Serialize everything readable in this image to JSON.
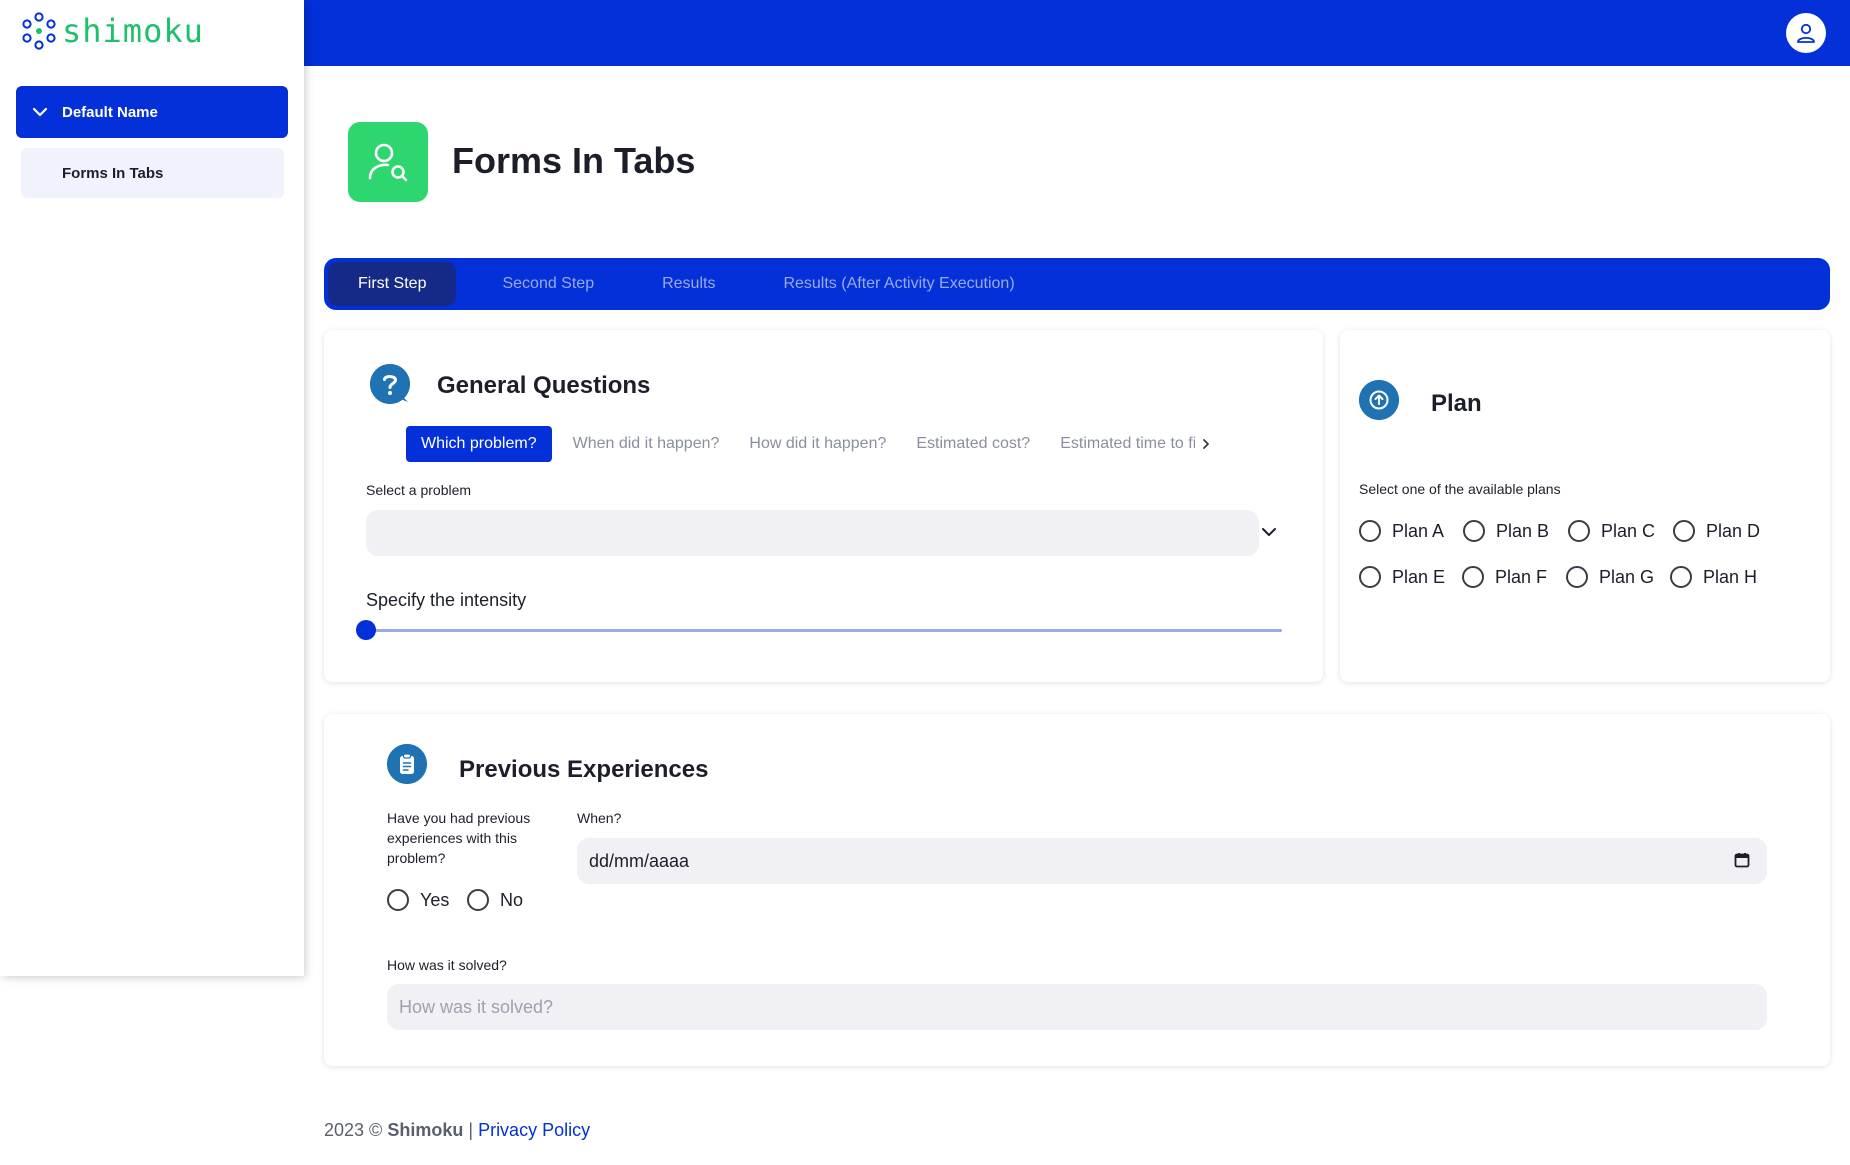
{
  "app": {
    "logo_text": "shimoku",
    "brand_color": "#0330d8",
    "accent_green": "#2ed66f"
  },
  "sidebar": {
    "group_label": "Default Name",
    "items": [
      {
        "label": "Forms In Tabs",
        "active": true
      }
    ]
  },
  "header": {
    "title": "Forms In Tabs",
    "icon": "user-search-icon"
  },
  "tabs": [
    {
      "label": "First Step",
      "active": true
    },
    {
      "label": "Second Step",
      "active": false
    },
    {
      "label": "Results",
      "active": false
    },
    {
      "label": "Results (After Activity Execution)",
      "active": false
    }
  ],
  "general_questions": {
    "title": "General Questions",
    "icon": "question-bubble-icon",
    "subtabs": [
      {
        "label": "Which problem?",
        "active": true
      },
      {
        "label": "When did it happen?",
        "active": false
      },
      {
        "label": "How did it happen?",
        "active": false
      },
      {
        "label": "Estimated cost?",
        "active": false
      },
      {
        "label": "Estimated time to fi",
        "active": false
      }
    ],
    "select_label": "Select a problem",
    "select_value": "",
    "slider_label": "Specify the intensity",
    "slider_value": 0
  },
  "plan": {
    "title": "Plan",
    "icon": "arrow-up-circle-icon",
    "label": "Select one of the available plans",
    "options_row1": [
      "Plan A",
      "Plan B",
      "Plan C",
      "Plan D"
    ],
    "options_row2": [
      "Plan E",
      "Plan F",
      "Plan G",
      "Plan H"
    ]
  },
  "previous_experiences": {
    "title": "Previous Experiences",
    "icon": "clipboard-icon",
    "question_label": "Have you had previous experiences with this problem?",
    "options": [
      "Yes",
      "No"
    ],
    "when_label": "When?",
    "date_placeholder": "dd/mm/aaaa",
    "solved_label": "How was it solved?",
    "solved_placeholder": "How was it solved?"
  },
  "footer": {
    "year_text": "2023 ©",
    "brand": "Shimoku",
    "separator": "|",
    "privacy": "Privacy Policy"
  }
}
